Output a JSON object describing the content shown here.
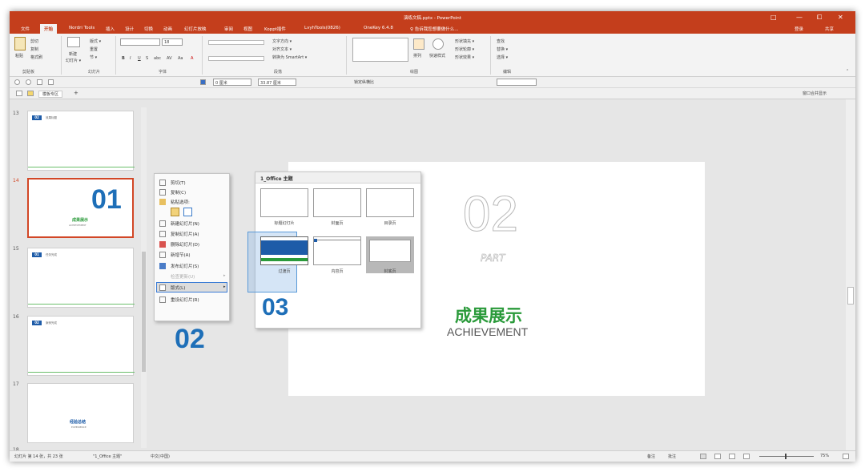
{
  "window": {
    "title": "演练文稿.pptx - PowerPoint",
    "controls": [
      "□",
      "—",
      "⧠",
      "✕"
    ]
  },
  "ribbon_tabs": [
    "文件",
    "开始",
    "Nordri Tools",
    "插入",
    "设计",
    "切换",
    "动画",
    "幻灯片放映",
    "审阅",
    "视图",
    "Koppt插件",
    "LvyhTools(0826)",
    "OneKey 6.4.8"
  ],
  "tell_me": "♀ 告诉我您想要做什么...",
  "user": {
    "share": "共享",
    "sign": "登录"
  },
  "ribbon": {
    "clipboard": {
      "paste": "粘贴",
      "cut": "剪切",
      "copy": "复制",
      "format_painter": "格式刷",
      "group": "剪贴板"
    },
    "slides": {
      "new_slide": "新建",
      "new_slide2": "幻灯片 ▾",
      "layout": "版式 ▾",
      "reset": "重置",
      "section": "节 ▾",
      "group": "幻灯片"
    },
    "font": {
      "size": "18",
      "group": "字体",
      "bold": "B",
      "italic": "I",
      "underline": "U",
      "strike": "S",
      "abc": "abc",
      "spacing": "AV",
      "case": "Aa",
      "color": "A"
    },
    "paragraph": {
      "group": "段落",
      "text_dir": "文字方向 ▾",
      "align_text": "对齐文本 ▾",
      "smartart": "转换为 SmartArt ▾"
    },
    "drawing": {
      "group": "绘图",
      "arrange": "排列",
      "quick_styles": "快速样式",
      "fill": "形状填充 ▾",
      "outline": "形状轮廓 ▾",
      "effects": "形状效果 ▾"
    },
    "editing": {
      "group": "编辑",
      "find": "查找",
      "replace": "替换 ▾",
      "select": "选择 ▾"
    }
  },
  "qat": {
    "width": "0 厘米",
    "width2": "33.87 厘米",
    "lock": "锁定纵横比"
  },
  "doc_tab": {
    "label": "模板专区",
    "plus": "+",
    "right": "窗口合并显示"
  },
  "thumbnails": [
    {
      "num": "13",
      "pill": "02",
      "text": "效果标题"
    },
    {
      "num": "14",
      "big": "01",
      "title": "成果展示",
      "sub": "ACHIEVEMENT"
    },
    {
      "num": "15",
      "pill": "01",
      "text": "任务完成"
    },
    {
      "num": "16",
      "pill": "02",
      "text": "案例完成"
    },
    {
      "num": "17",
      "title": "经验总结",
      "sub": "EXPERIENCE"
    },
    {
      "num": "18"
    }
  ],
  "context_menu": {
    "items": [
      "剪切(T)",
      "复制(C)",
      "粘贴选项:",
      "新建幻灯片(N)",
      "复制幻灯片(A)",
      "删除幻灯片(D)",
      "新增节(A)",
      "发布幻灯片(S)",
      "检查更新(U)",
      "版式(L)",
      "重设幻灯片(R)"
    ]
  },
  "layout_gallery": {
    "theme": "1_Office 主题",
    "layouts": [
      "标题幻灯片",
      "封面页",
      "目录页",
      "过渡页",
      "内容页",
      "封底页"
    ]
  },
  "callouts": {
    "c02": "02",
    "c03": "03"
  },
  "slide": {
    "big": "02",
    "part": "PART",
    "title": "成果展示",
    "subtitle": "ACHIEVEMENT"
  },
  "status": {
    "left": "幻灯片 第 14 张，共 23 张",
    "theme": "\"1_Office 主题\"",
    "lang": "中文(中国)",
    "notes": "备注",
    "comments": "批注",
    "zoom": "75%"
  }
}
